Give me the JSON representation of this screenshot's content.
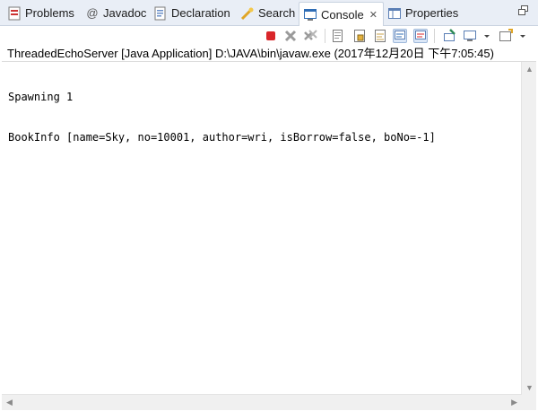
{
  "tabs": [
    {
      "label": "Problems",
      "icon": "problems-icon"
    },
    {
      "label": "Javadoc",
      "icon": "javadoc-icon"
    },
    {
      "label": "Declaration",
      "icon": "declaration-icon"
    },
    {
      "label": "Search",
      "icon": "search-icon"
    },
    {
      "label": "Console",
      "icon": "console-icon",
      "active": true,
      "close": "✕"
    },
    {
      "label": "Properties",
      "icon": "properties-icon"
    }
  ],
  "toolbar": {
    "buttons": [
      "terminate-icon",
      "remove-launch-icon",
      "remove-all-terminated-icon",
      "clear-console-icon",
      "scroll-lock-icon",
      "word-wrap-icon",
      "show-on-stdout-icon",
      "show-on-stderr-icon",
      "pin-console-icon",
      "display-console-icon",
      "open-console-icon"
    ]
  },
  "process_label": "ThreadedEchoServer [Java Application] D:\\JAVA\\bin\\javaw.exe (2017年12月20日 下午7:05:45)",
  "console": {
    "lines": [
      "Spawning 1",
      "BookInfo [name=Sky, no=10001, author=wri, isBorrow=false, boNo=-1]"
    ]
  },
  "colors": {
    "tabbar_bg": "#e9eef6",
    "terminate_red": "#d9262a",
    "accent_blue": "#2f6db5"
  }
}
